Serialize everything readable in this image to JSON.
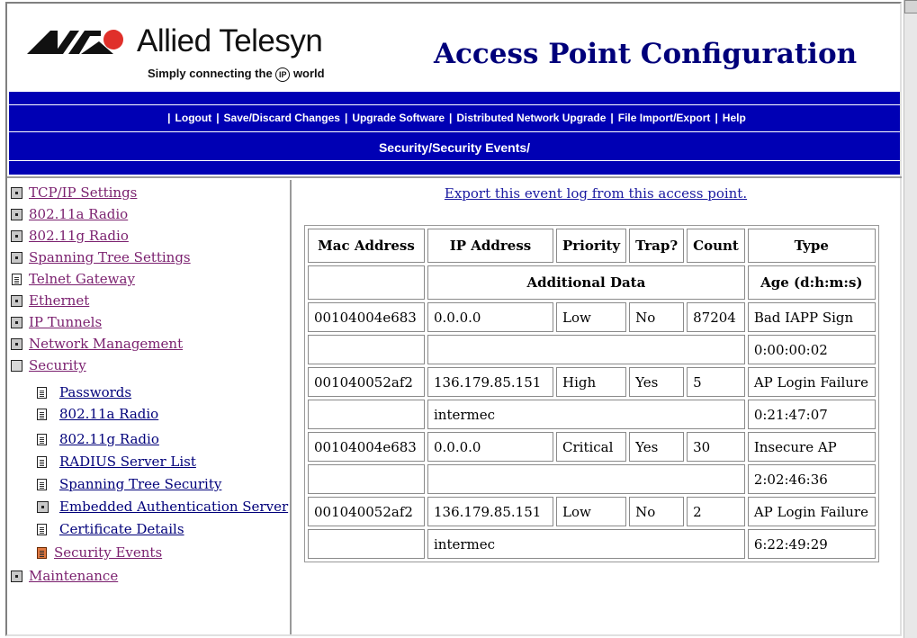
{
  "brand": {
    "name": "Allied Telesyn",
    "tagline_pre": "Simply connecting the",
    "tagline_ip": "IP",
    "tagline_post": "world"
  },
  "app_title": "Access Point Configuration",
  "nav": {
    "items": [
      "Logout",
      "Save/Discard Changes",
      "Upgrade Software",
      "Distributed Network Upgrade",
      "File Import/Export",
      "Help"
    ]
  },
  "breadcrumb": "Security/Security Events/",
  "sidebar": {
    "items": [
      {
        "label": "TCP/IP Settings",
        "icon": "folder-icon"
      },
      {
        "label": "802.11a Radio",
        "icon": "folder-icon"
      },
      {
        "label": "802.11g Radio",
        "icon": "folder-icon"
      },
      {
        "label": "Spanning Tree Settings",
        "icon": "folder-icon"
      },
      {
        "label": "Telnet Gateway",
        "icon": "document-icon"
      },
      {
        "label": "Ethernet",
        "icon": "folder-icon"
      },
      {
        "label": "IP Tunnels",
        "icon": "folder-icon"
      },
      {
        "label": "Network Management",
        "icon": "folder-icon"
      },
      {
        "label": "Security",
        "icon": "open-folder-icon"
      },
      {
        "label": "Passwords",
        "icon": "document-icon"
      },
      {
        "label": "802.11a Radio",
        "icon": "document-icon"
      },
      {
        "label": "802.11g Radio",
        "icon": "document-icon"
      },
      {
        "label": "RADIUS Server List",
        "icon": "document-icon"
      },
      {
        "label": "Spanning Tree Security",
        "icon": "document-icon"
      },
      {
        "label": "Embedded Authentication Server",
        "icon": "folder-icon"
      },
      {
        "label": "Certificate Details",
        "icon": "document-icon"
      },
      {
        "label": "Security Events",
        "icon": "document-icon-active"
      },
      {
        "label": "Maintenance",
        "icon": "folder-icon"
      }
    ]
  },
  "export_link": "Export this event log from this access point.",
  "table": {
    "headers": [
      "Mac Address",
      "IP Address",
      "Priority",
      "Trap?",
      "Count",
      "Type"
    ],
    "subheaders": {
      "additional": "Additional Data",
      "age": "Age (d:h:m:s)"
    },
    "rows": [
      {
        "mac": "00104004e683",
        "ip": "0.0.0.0",
        "priority": "Low",
        "trap": "No",
        "count": "87204",
        "type": "Bad IAPP Sign",
        "additional": "",
        "age": "0:00:00:02"
      },
      {
        "mac": "001040052af2",
        "ip": "136.179.85.151",
        "priority": "High",
        "trap": "Yes",
        "count": "5",
        "type": "AP Login Failure",
        "additional": "intermec",
        "age": "0:21:47:07"
      },
      {
        "mac": "00104004e683",
        "ip": "0.0.0.0",
        "priority": "Critical",
        "trap": "Yes",
        "count": "30",
        "type": "Insecure AP",
        "additional": "",
        "age": "2:02:46:36"
      },
      {
        "mac": "001040052af2",
        "ip": "136.179.85.151",
        "priority": "Low",
        "trap": "No",
        "count": "2",
        "type": "AP Login Failure",
        "additional": "intermec",
        "age": "6:22:49:29"
      }
    ]
  },
  "colors": {
    "nav_bar": "#0000b4",
    "title": "#00007a",
    "link": "#7a1f6e"
  }
}
